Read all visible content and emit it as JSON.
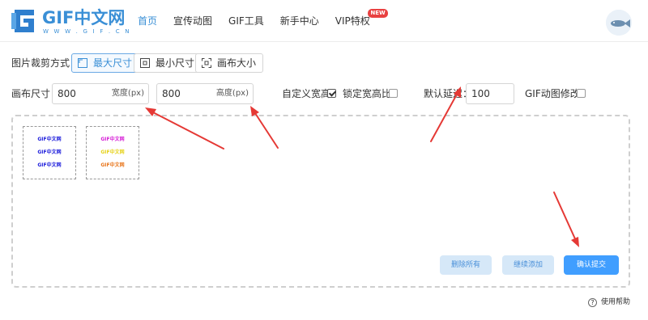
{
  "header": {
    "logo": {
      "title": "GIF中文网",
      "subtitle": "W W W . G I F . C N"
    },
    "nav": [
      {
        "label": "首页",
        "active": true
      },
      {
        "label": "宣传动图",
        "active": false
      },
      {
        "label": "GIF工具",
        "active": false
      },
      {
        "label": "新手中心",
        "active": false
      },
      {
        "label": "VIP特权",
        "active": false,
        "badge": "NEW"
      }
    ]
  },
  "crop": {
    "label": "图片裁剪方式：",
    "options": [
      {
        "label": "最大尺寸",
        "icon": "expand-icon",
        "active": true
      },
      {
        "label": "最小尺寸",
        "icon": "shrink-icon",
        "active": false
      },
      {
        "label": "画布大小",
        "icon": "canvas-icon",
        "active": false
      }
    ]
  },
  "canvas": {
    "label": "画布尺寸：",
    "width": {
      "value": "800",
      "suffix": "宽度(px)"
    },
    "height": {
      "value": "800",
      "suffix": "高度(px)"
    },
    "custom_size": {
      "label": "自定义宽高",
      "checked": true
    },
    "lock_ratio": {
      "label": "锁定宽高比",
      "checked": false
    },
    "delay": {
      "label": "默认延迟：",
      "value": "100"
    },
    "gif_edit": {
      "label": "GIF动图修改",
      "checked": false
    }
  },
  "thumbnails": [
    {
      "lines": [
        {
          "text": "GIF中文网",
          "color": "#1a1adb"
        },
        {
          "text": "GIF中文网",
          "color": "#1a1adb"
        },
        {
          "text": "GIF中文网",
          "color": "#1a1adb"
        }
      ]
    },
    {
      "lines": [
        {
          "text": "GIF中文网",
          "color": "#d61fd6"
        },
        {
          "text": "GIF中文网",
          "color": "#e6d21a"
        },
        {
          "text": "GIF中文网",
          "color": "#e8761c"
        }
      ]
    }
  ],
  "actions": {
    "delete_all": "删除所有",
    "continue_add": "继续添加",
    "confirm": "确认提交"
  },
  "help": {
    "label": "使用帮助"
  },
  "colors": {
    "accent": "#3a8fd6",
    "primary_button": "#409eff",
    "arrow": "#e53935",
    "badge": "#e94141"
  }
}
